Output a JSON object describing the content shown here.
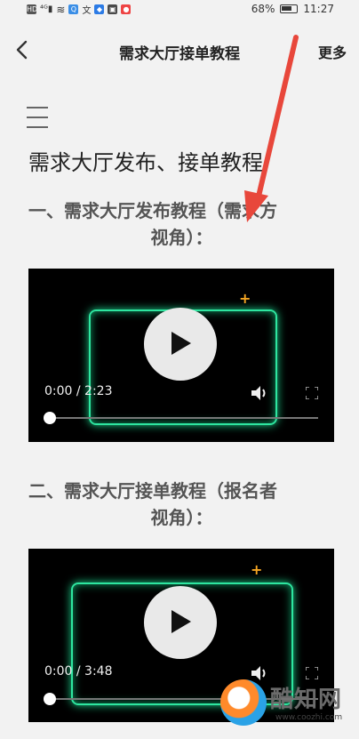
{
  "status_bar": {
    "left_icons": [
      "HD",
      "4G",
      "wifi-icon",
      "app-icons"
    ],
    "battery_percent": "68%",
    "battery_level": 0.68,
    "time": "11:27"
  },
  "nav": {
    "title": "需求大厅接单教程",
    "more_label": "更多"
  },
  "article": {
    "title": "需求大厅发布、接单教程",
    "sections": [
      {
        "heading_line1": "一、需求大厅发布教程（需求方",
        "heading_line2": "视角）：",
        "video": {
          "time": "0:00 / 2:23",
          "progress": 0.0
        }
      },
      {
        "heading_line1": "二、需求大厅接单教程（报名者",
        "heading_line2": "视角）：",
        "video": {
          "time": "0:00 / 3:48",
          "progress": 0.0
        }
      }
    ]
  },
  "watermark": {
    "name": "酷知网",
    "url": "www.coozhi.com"
  },
  "colors": {
    "accent_green": "#2ee6a0",
    "arrow_red": "#e8473b",
    "sparkle_orange": "#f5a623",
    "background": "#f2f2f2"
  }
}
